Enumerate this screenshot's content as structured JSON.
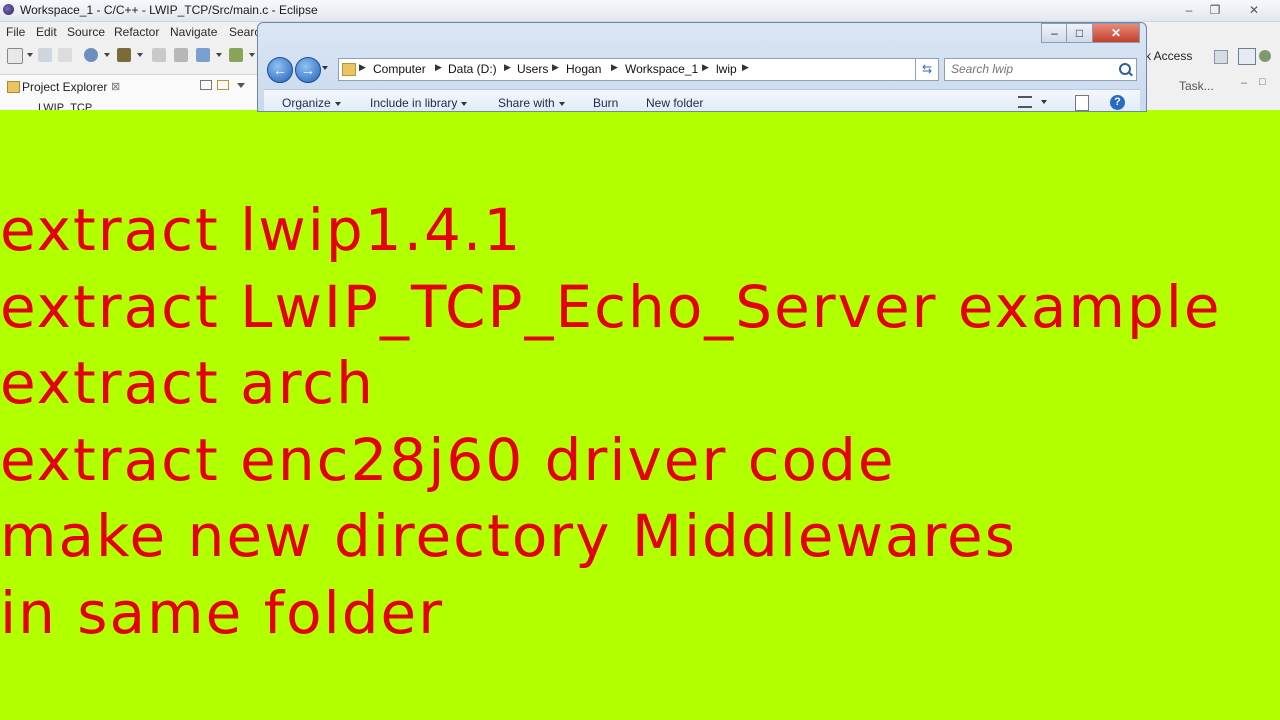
{
  "eclipse": {
    "title": "Workspace_1 - C/C++ - LWIP_TCP/Src/main.c - Eclipse",
    "menu": [
      "File",
      "Edit",
      "Source",
      "Refactor",
      "Navigate",
      "Searc"
    ],
    "quick_access": "k Access",
    "project_explorer": {
      "label": "Project Explorer",
      "close": "⊠",
      "tree_item": "LWIP_TCP"
    },
    "right_panel": {
      "tasks_label": "Task..."
    }
  },
  "explorer": {
    "breadcrumb": [
      "Computer",
      "Data (D:)",
      "Users",
      "Hogan",
      "Workspace_1",
      "lwip"
    ],
    "search": {
      "placeholder": "Search lwip"
    },
    "commands": {
      "organize": "Organize",
      "include_in_library": "Include in library",
      "share_with": "Share with",
      "burn": "Burn",
      "new_folder": "New folder"
    },
    "help": "?"
  },
  "overlay": {
    "lines": [
      "extract lwip1.4.1",
      "extract LwIP_TCP_Echo_Server example",
      "extract arch",
      "extract enc28j60 driver code",
      "make new directory Middlewares",
      "in same folder"
    ]
  },
  "colors": {
    "background": "#b2ff00",
    "overlay_text": "#e4000f"
  }
}
